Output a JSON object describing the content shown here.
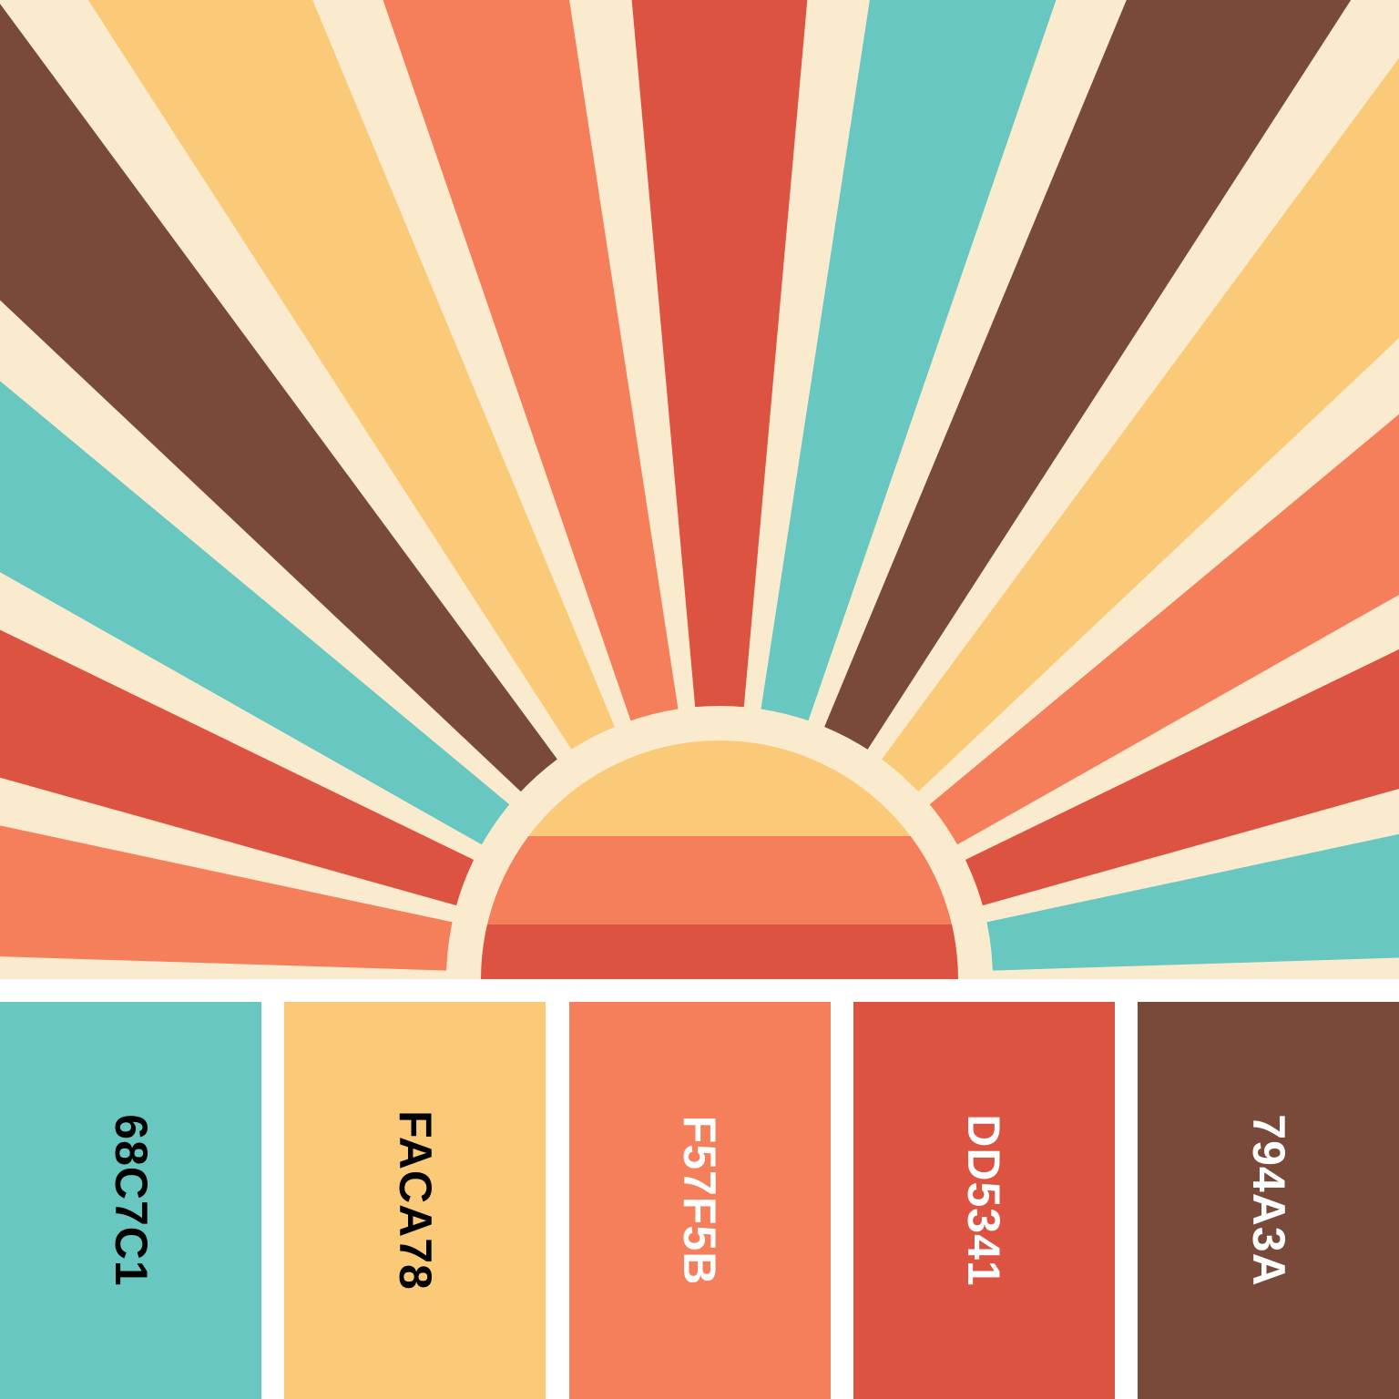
{
  "artwork": {
    "background": "#FAEBCE",
    "rays": [
      {
        "color": "#F57F5B",
        "name": "ray-coral"
      },
      {
        "color": "#DD5341",
        "name": "ray-red"
      },
      {
        "color": "#68C7C1",
        "name": "ray-teal"
      },
      {
        "color": "#794A3A",
        "name": "ray-brown"
      },
      {
        "color": "#FACA78",
        "name": "ray-yellow"
      },
      {
        "color": "#F57F5B",
        "name": "ray-coral"
      },
      {
        "color": "#DD5341",
        "name": "ray-red"
      },
      {
        "color": "#68C7C1",
        "name": "ray-teal"
      },
      {
        "color": "#794A3A",
        "name": "ray-brown"
      },
      {
        "color": "#FACA78",
        "name": "ray-yellow"
      },
      {
        "color": "#F57F5B",
        "name": "ray-coral"
      },
      {
        "color": "#DD5341",
        "name": "ray-red"
      },
      {
        "color": "#68C7C1",
        "name": "ray-teal"
      }
    ],
    "sun_bands": [
      "#FACA78",
      "#F57F5B",
      "#DD5341"
    ]
  },
  "palette": [
    {
      "hex": "68C7C1",
      "color": "#68C7C1",
      "text_color": "#000000"
    },
    {
      "hex": "FACA78",
      "color": "#FACA78",
      "text_color": "#000000"
    },
    {
      "hex": "F57F5B",
      "color": "#F57F5B",
      "text_color": "#ffffff"
    },
    {
      "hex": "DD5341",
      "color": "#DD5341",
      "text_color": "#ffffff"
    },
    {
      "hex": "794A3A",
      "color": "#794A3A",
      "text_color": "#ffffff"
    }
  ]
}
